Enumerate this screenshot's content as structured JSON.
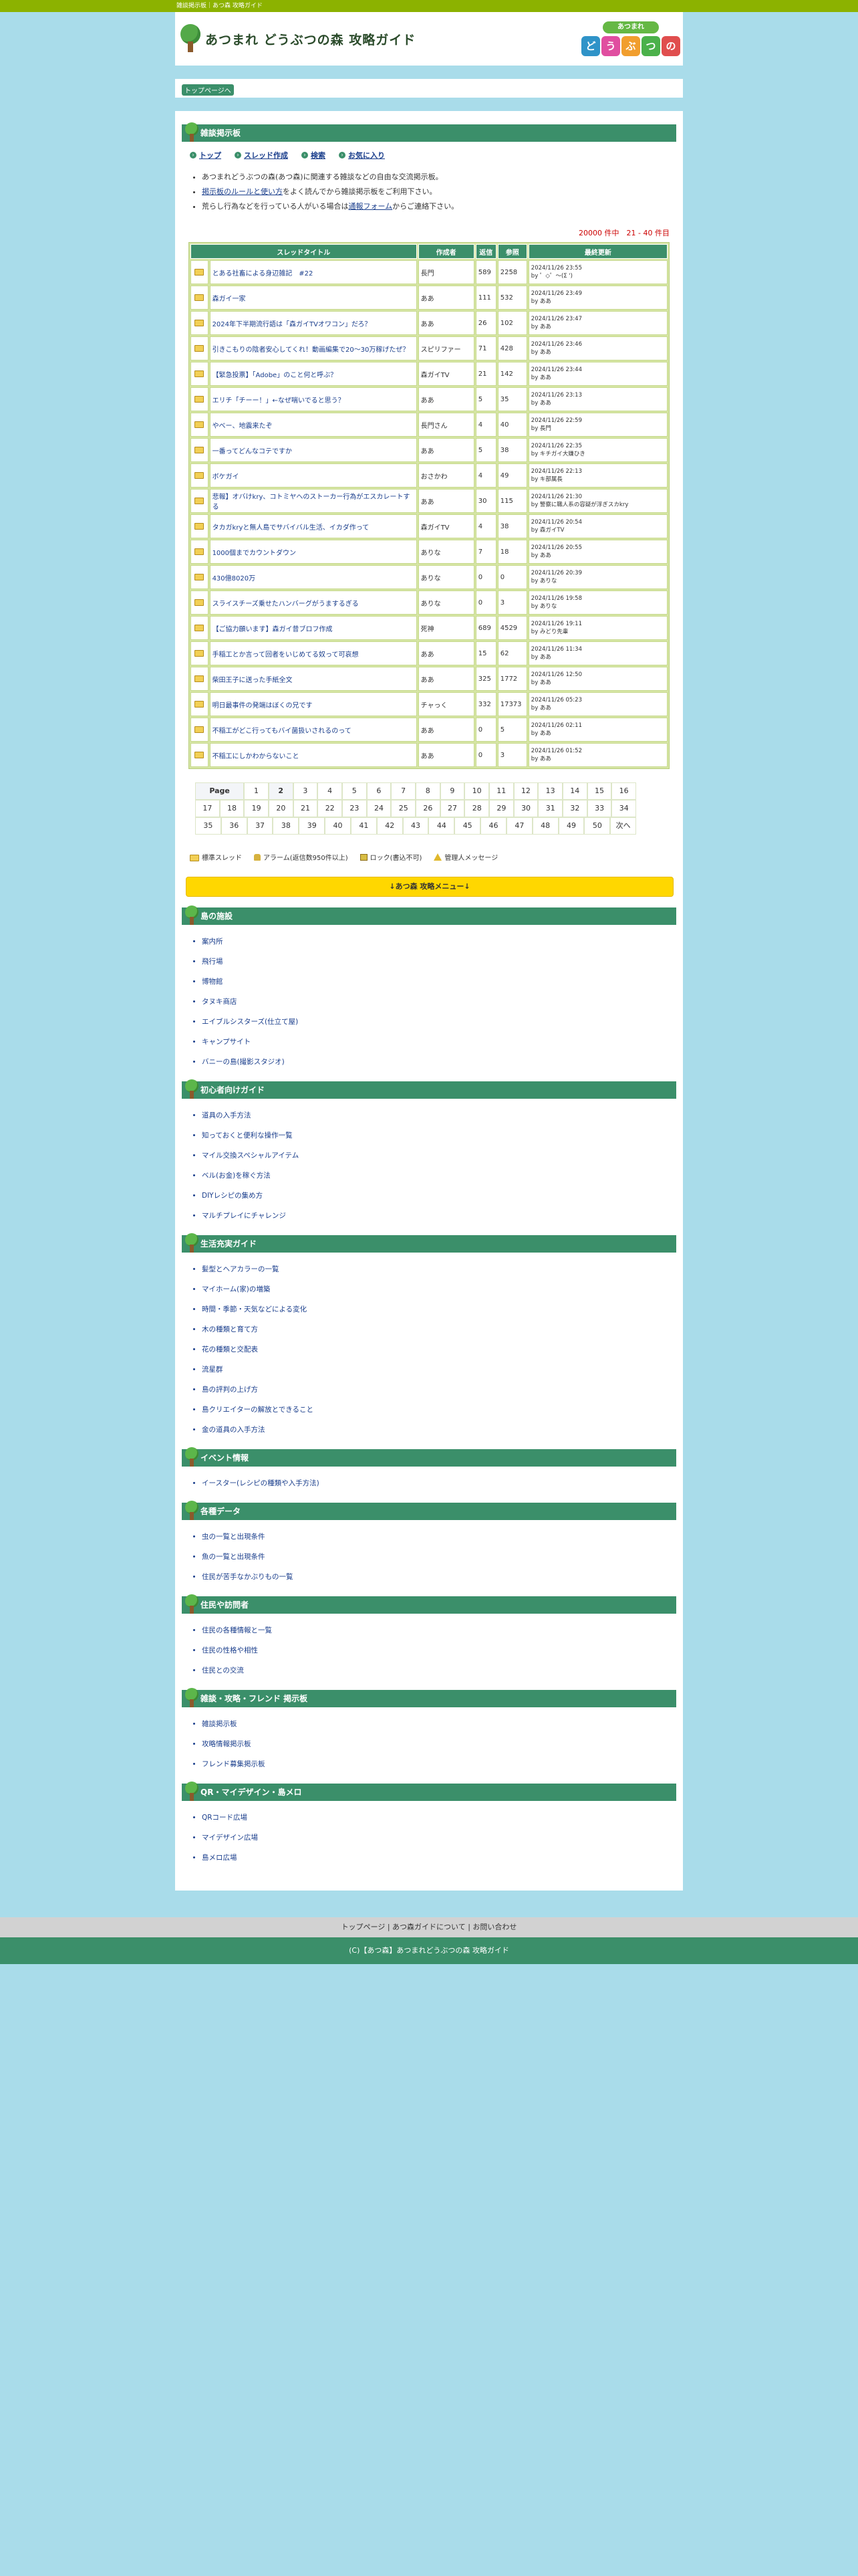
{
  "topbar": {
    "text": "雑談掲示板｜あつ森 攻略ガイド"
  },
  "site": {
    "title": "あつまれ どうぶつの森 攻略ガイド"
  },
  "game_logo": {
    "top": "あつまれ",
    "chars": [
      "ど",
      "う",
      "ぶ",
      "つ",
      "の"
    ],
    "colors": [
      "#2f93c8",
      "#e04ea0",
      "#f19e2e",
      "#4bb14a",
      "#e04e4e"
    ]
  },
  "breadcrumb": {
    "label": "トップページへ"
  },
  "board": {
    "heading": "雑談掲示板",
    "nav": [
      "トップ",
      "スレッド作成",
      "検索",
      "お気に入り"
    ],
    "notes": [
      {
        "before": "あつまれどうぶつの森(あつ森)に関連する雑談などの自由な交流掲示板。",
        "link": "",
        "after": ""
      },
      {
        "before": "",
        "link": "掲示板のルールと使い方",
        "after": "をよく読んでから雑談掲示板をご利用下さい。"
      },
      {
        "before": "荒らし行為などを行っている人がいる場合は",
        "link": "通報フォーム",
        "after": "からご連絡下さい。"
      }
    ],
    "count": "20000 件中　21 - 40 件目",
    "columns": [
      "スレッドタイトル",
      "作成者",
      "返信",
      "参照",
      "最終更新"
    ],
    "threads": [
      {
        "title": "とある社畜による身辺雑記　#22",
        "author": "長門",
        "replies": "589",
        "views": "2258",
        "updated": "2024/11/26 23:55",
        "by": "by ゜◇゜〜(Σ ')"
      },
      {
        "title": "森ガイ一家",
        "author": "ああ",
        "replies": "111",
        "views": "532",
        "updated": "2024/11/26 23:49",
        "by": "by ああ"
      },
      {
        "title": "2024年下半期流行語は「森ガイTVオワコン」だろ？",
        "author": "ああ",
        "replies": "26",
        "views": "102",
        "updated": "2024/11/26 23:47",
        "by": "by ああ"
      },
      {
        "title": "引きこもりの陰者安心してくれ！動画編集で20〜30万稼げたぜ？",
        "author": "スピリファー",
        "replies": "71",
        "views": "428",
        "updated": "2024/11/26 23:46",
        "by": "by ああ"
      },
      {
        "title": "【緊急投票】「Adobe」のこと何と呼ぶ？",
        "author": "森ガイTV",
        "replies": "21",
        "views": "142",
        "updated": "2024/11/26 23:44",
        "by": "by ああ"
      },
      {
        "title": "エリチ「チーー！」←なぜ喘いでると思う？",
        "author": "ああ",
        "replies": "5",
        "views": "35",
        "updated": "2024/11/26 23:13",
        "by": "by ああ"
      },
      {
        "title": "やべー、地震来たぞ",
        "author": "長門さん",
        "replies": "4",
        "views": "40",
        "updated": "2024/11/26 22:59",
        "by": "by 長門"
      },
      {
        "title": "一番ってどんなコテですか",
        "author": "ああ",
        "replies": "5",
        "views": "38",
        "updated": "2024/11/26 22:35",
        "by": "by キチガイ大嫌ひき"
      },
      {
        "title": "ボケガイ",
        "author": "おさかわ",
        "replies": "4",
        "views": "49",
        "updated": "2024/11/26 22:13",
        "by": "by キ部属長"
      },
      {
        "title": "悲報】オバけkry、コトミヤへのストーカー行為がエスカレートする",
        "author": "ああ",
        "replies": "30",
        "views": "115",
        "updated": "2024/11/26 21:30",
        "by": "by 警察に職人系の容疑が浮ぎスカkry"
      },
      {
        "title": "タカガkryと無人島でサバイバル生活、イカダ作って",
        "author": "森ガイTV",
        "replies": "4",
        "views": "38",
        "updated": "2024/11/26 20:54",
        "by": "by 森ガイTV"
      },
      {
        "title": "1000個までカウントダウン",
        "author": "ありな",
        "replies": "7",
        "views": "18",
        "updated": "2024/11/26 20:55",
        "by": "by ああ"
      },
      {
        "title": "430億8020万",
        "author": "ありな",
        "replies": "0",
        "views": "0",
        "updated": "2024/11/26 20:39",
        "by": "by ありな"
      },
      {
        "title": "スライスチーズ乗せたハンバーグがうまするぎる",
        "author": "ありな",
        "replies": "0",
        "views": "3",
        "updated": "2024/11/26 19:58",
        "by": "by ありな"
      },
      {
        "title": "【ご協力願います】森ガイ昔ブロフ作成",
        "author": "死神",
        "replies": "689",
        "views": "4529",
        "updated": "2024/11/26 19:11",
        "by": "by みどり先輩"
      },
      {
        "title": "手稲工とか言って回者をいじめてる奴って可哀想",
        "author": "ああ",
        "replies": "15",
        "views": "62",
        "updated": "2024/11/26 11:34",
        "by": "by ああ"
      },
      {
        "title": "柴田王子に送った手紙全文",
        "author": "ああ",
        "replies": "325",
        "views": "1772",
        "updated": "2024/11/26 12:50",
        "by": "by ああ"
      },
      {
        "title": "明日最事件の発端はぼくの兄です",
        "author": "チャっく",
        "replies": "332",
        "views": "17373",
        "updated": "2024/11/26 05:23",
        "by": "by ああ"
      },
      {
        "title": "不稲工がどこ行ってもバイ菌扱いされるのって",
        "author": "ああ",
        "replies": "0",
        "views": "5",
        "updated": "2024/11/26 02:11",
        "by": "by ああ"
      },
      {
        "title": "不稲工にしかわからないこと",
        "author": "ああ",
        "replies": "0",
        "views": "3",
        "updated": "2024/11/26 01:52",
        "by": "by ああ"
      }
    ]
  },
  "pager": {
    "label": "Page",
    "current": "2",
    "row1": [
      "1",
      "2",
      "3",
      "4",
      "5",
      "6",
      "7",
      "8",
      "9",
      "10",
      "11",
      "12",
      "13",
      "14",
      "15",
      "16"
    ],
    "row2": [
      "17",
      "18",
      "19",
      "20",
      "21",
      "22",
      "23",
      "24",
      "25",
      "26",
      "27",
      "28",
      "29",
      "30",
      "31",
      "32",
      "33",
      "34"
    ],
    "row3": [
      "35",
      "36",
      "37",
      "38",
      "39",
      "40",
      "41",
      "42",
      "43",
      "44",
      "45",
      "46",
      "47",
      "48",
      "49",
      "50",
      "次へ"
    ]
  },
  "legend": [
    "標準スレッド",
    "アラーム(返信数950件以上)",
    "ロック(書込不可)",
    "管理人メッセージ"
  ],
  "menu_button": "↓あつ森 攻略メニュー↓",
  "categories": [
    {
      "title": "島の施設",
      "items": [
        "案内所",
        "飛行場",
        "博物館",
        "タヌキ商店",
        "エイブルシスターズ(仕立て屋)",
        "キャンプサイト",
        "バニーの島(撮影スタジオ)"
      ]
    },
    {
      "title": "初心者向けガイド",
      "items": [
        "道具の入手方法",
        "知っておくと便利な操作一覧",
        "マイル交換スペシャルアイテム",
        "ベル(お金)を稼ぐ方法",
        "DIYレシピの集め方",
        "マルチプレイにチャレンジ"
      ]
    },
    {
      "title": "生活充実ガイド",
      "items": [
        "髪型とヘアカラーの一覧",
        "マイホーム(家)の増築",
        "時間・季節・天気などによる変化",
        "木の種類と育て方",
        "花の種類と交配表",
        "流星群",
        "島の評判の上げ方",
        "島クリエイターの解放とできること",
        "金の道具の入手方法"
      ]
    },
    {
      "title": "イベント情報",
      "items": [
        "イースター(レシピの種類や入手方法)"
      ]
    },
    {
      "title": "各種データ",
      "items": [
        "虫の一覧と出現条件",
        "魚の一覧と出現条件",
        "住民が苦手なかぶりもの一覧"
      ]
    },
    {
      "title": "住民や訪問者",
      "items": [
        "住民の各種情報と一覧",
        "住民の性格や相性",
        "住民との交流"
      ]
    },
    {
      "title": "雑談・攻略・フレンド 掲示板",
      "items": [
        "雑談掲示板",
        "攻略情報掲示板",
        "フレンド募集掲示板"
      ]
    },
    {
      "title": "QR・マイデザイン・島メロ",
      "items": [
        "QRコード広場",
        "マイデザイン広場",
        "島メロ広場"
      ]
    }
  ],
  "footer": {
    "links": "トップページ | あつ森ガイドについて | お問い合わせ",
    "copyright": "(C)【あつ森】あつまれどうぶつの森 攻略ガイド"
  }
}
